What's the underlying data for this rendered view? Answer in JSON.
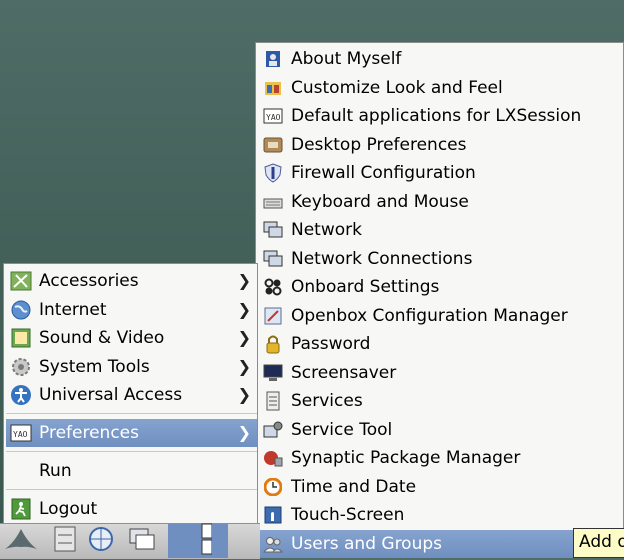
{
  "main_menu": {
    "items": [
      {
        "label": "Accessories",
        "icon": "accessories-icon",
        "submenu": true
      },
      {
        "label": "Internet",
        "icon": "internet-icon",
        "submenu": true
      },
      {
        "label": "Sound & Video",
        "icon": "sound-video-icon",
        "submenu": true
      },
      {
        "label": "System Tools",
        "icon": "system-tools-icon",
        "submenu": true
      },
      {
        "label": "Universal Access",
        "icon": "universal-access-icon",
        "submenu": true
      },
      {
        "label": "Preferences",
        "icon": "preferences-icon",
        "submenu": true,
        "selected": true
      },
      {
        "label": "Run"
      },
      {
        "label": "Logout",
        "icon": "logout-icon"
      }
    ],
    "arrow_glyph": "❯"
  },
  "preferences_submenu": {
    "items": [
      {
        "label": "About Myself",
        "icon": "about-myself-icon"
      },
      {
        "label": "Customize Look and Feel",
        "icon": "customize-look-icon"
      },
      {
        "label": "Default applications for LXSession",
        "icon": "lxsession-icon"
      },
      {
        "label": "Desktop Preferences",
        "icon": "desktop-preferences-icon"
      },
      {
        "label": "Firewall Configuration",
        "icon": "firewall-icon"
      },
      {
        "label": "Keyboard and Mouse",
        "icon": "keyboard-icon"
      },
      {
        "label": "Network",
        "icon": "network-icon"
      },
      {
        "label": "Network Connections",
        "icon": "network-connections-icon"
      },
      {
        "label": "Onboard Settings",
        "icon": "onboard-icon"
      },
      {
        "label": "Openbox Configuration Manager",
        "icon": "openbox-icon"
      },
      {
        "label": "Password",
        "icon": "password-lock-icon"
      },
      {
        "label": "Screensaver",
        "icon": "screensaver-icon"
      },
      {
        "label": "Services",
        "icon": "services-icon"
      },
      {
        "label": "Service Tool",
        "icon": "service-tool-icon"
      },
      {
        "label": "Synaptic Package Manager",
        "icon": "synaptic-icon"
      },
      {
        "label": "Time and Date",
        "icon": "time-date-icon"
      },
      {
        "label": "Touch-Screen",
        "icon": "touchscreen-icon"
      },
      {
        "label": "Users and Groups",
        "icon": "users-groups-icon",
        "selected": true
      }
    ]
  },
  "tooltip": {
    "text": "Add o"
  },
  "colors": {
    "selection": "#7896c7",
    "menu_bg": "#f7f7f6",
    "tooltip_bg": "#fdfbc6"
  }
}
